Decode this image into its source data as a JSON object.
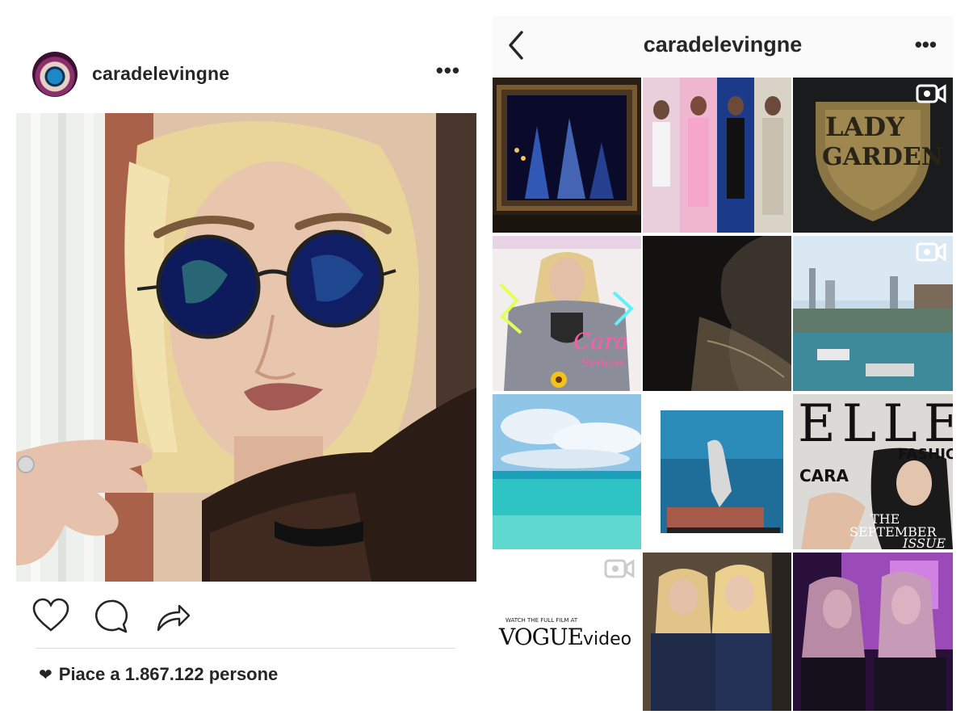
{
  "post": {
    "username": "caradelevingne",
    "more_label": "•••",
    "likes_text": "Piace a 1.867.122 persone",
    "like_heart": "❤",
    "icons": [
      "heart-icon",
      "comment-icon",
      "share-icon"
    ]
  },
  "profile": {
    "username": "caradelevingne",
    "more_label": "•••",
    "back_icon": "chevron-left-icon"
  },
  "grid_text": {
    "lady_garden_1": "LADY",
    "lady_garden_2": "GARDEN",
    "elle": "ELLE",
    "elle_fashion": "FASHION",
    "elle_cara": "CARA",
    "elle_the": "THE",
    "elle_september": "SEPTEMBER",
    "elle_issue": "ISSUE",
    "vogue_watch": "WATCH THE FULL FILM AT",
    "vogue_brand": "VOGUE",
    "vogue_video": "video",
    "cara_word": "Cara",
    "serious_word": "Serious"
  }
}
